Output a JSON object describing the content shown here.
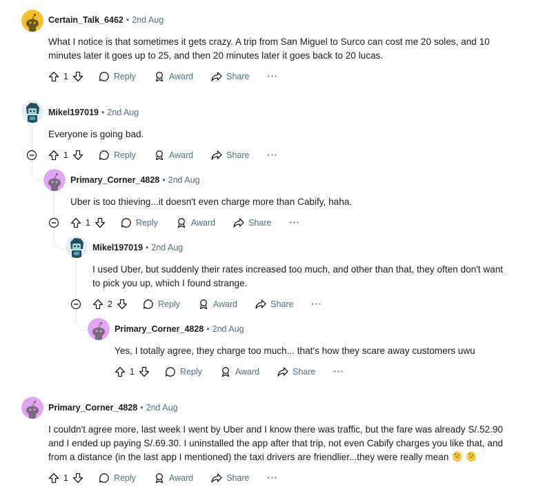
{
  "labels": {
    "reply": "Reply",
    "award": "Award",
    "share": "Share",
    "more": "···",
    "separator": "•"
  },
  "colors": {
    "text": "#1c1c1c",
    "meta": "#576f76",
    "thread_line": "#e5ebee",
    "avatar_purple": "#dfa6f2",
    "avatar_yellow": "#f6c02b",
    "avatar_dark": "#2c4c57"
  },
  "comments": [
    {
      "username": "Certain_Talk_6462",
      "time": "2nd Aug",
      "avatar": "yellow-snoo-avatar",
      "lines": [
        "What I notice is that sometimes it gets crazy. A trip from San Miguel to Surco can cost me 20 soles, and 10",
        "minutes later it goes up to 25, and then 20 minutes later it goes back to 20 lucas."
      ],
      "votes": "1"
    },
    {
      "username": "Mikel197019",
      "time": "2nd Aug",
      "avatar": "dark-custom-avatar",
      "lines": [
        "Everyone is going bad."
      ],
      "votes": "1"
    },
    {
      "username": "Primary_Corner_4828",
      "time": "2nd Aug",
      "avatar": "purple-snoo-avatar",
      "lines": [
        "Uber is too thieving...it doesn't even charge more than Cabify, haha."
      ],
      "votes": "1"
    },
    {
      "username": "Mikel197019",
      "time": "2nd Aug",
      "avatar": "dark-custom-avatar",
      "lines": [
        "I used Uber, but suddenly their rates increased too much, and other than that, they often don't want",
        "to pick you up, which I found strange."
      ],
      "votes": "2"
    },
    {
      "username": "Primary_Corner_4828",
      "time": "2nd Aug",
      "avatar": "purple-snoo-avatar",
      "lines": [
        "Yes, I totally agree, they charge too much... that's how they scare away customers uwu"
      ],
      "votes": "1"
    },
    {
      "username": "Primary_Corner_4828",
      "time": "2nd Aug",
      "avatar": "purple-snoo-avatar",
      "lines": [
        "I couldn't agree more, last week I went by Uber and I know there was traffic, but the fare was already S/.52.90",
        "and I ended up paying S/.69.30. I uninstalled the app after that trip, not even Cabify charges you like that, and",
        "from a distance (in the last app I mentioned) the taxi drivers are friendlier...they were really mean"
      ],
      "emoji": [
        "🫠",
        "🫠"
      ],
      "votes": "1"
    }
  ]
}
